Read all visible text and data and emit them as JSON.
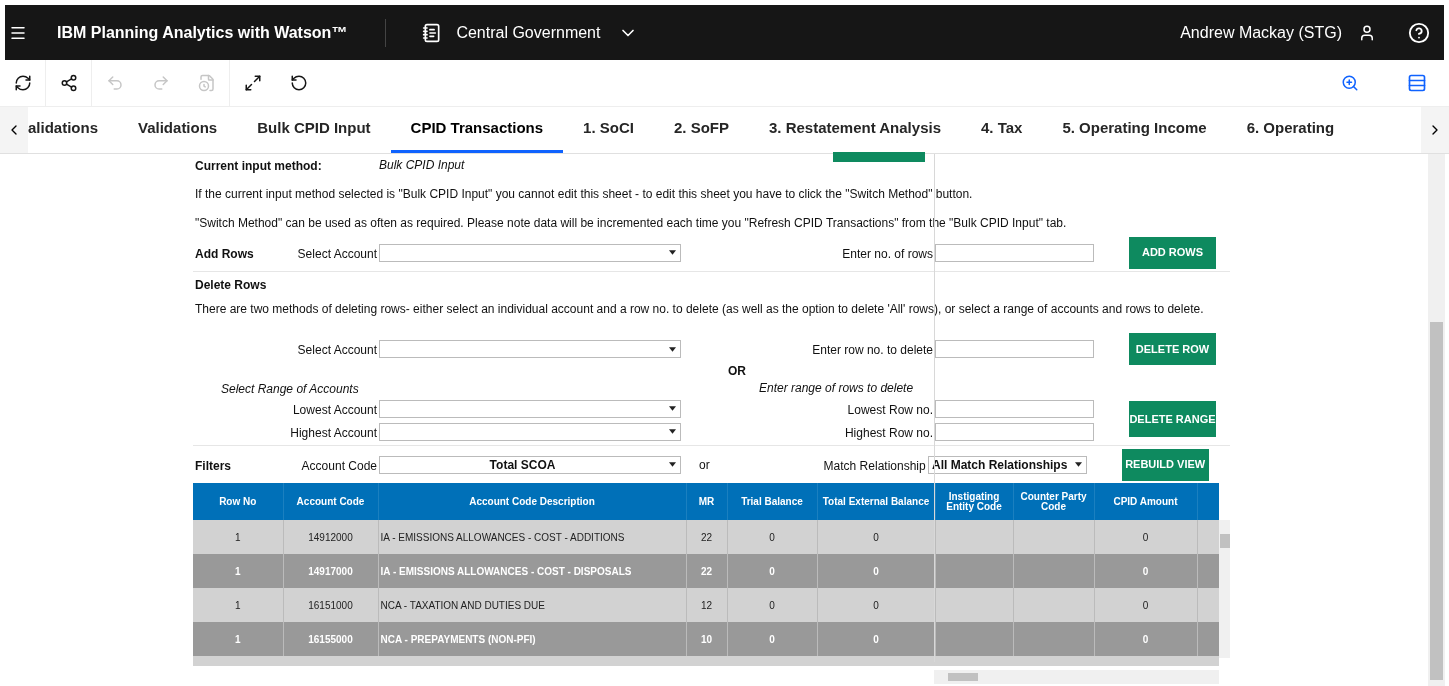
{
  "header": {
    "app_title": "IBM Planning Analytics with Watson™",
    "workbook": "Central Government",
    "user": "Andrew Mackay (STG)"
  },
  "toolbar": [
    {
      "kind": "refresh",
      "disabled": false
    },
    {
      "kind": "share",
      "disabled": false
    },
    {
      "kind": "undo",
      "disabled": true
    },
    {
      "kind": "redo",
      "disabled": true
    },
    {
      "kind": "revert",
      "disabled": true
    },
    {
      "kind": "expand",
      "disabled": false
    },
    {
      "kind": "reset",
      "disabled": false
    }
  ],
  "tabs": [
    {
      "label": "alidations",
      "selected": false
    },
    {
      "label": "Validations",
      "selected": false
    },
    {
      "label": "Bulk CPID Input",
      "selected": false
    },
    {
      "label": "CPID Transactions",
      "selected": true
    },
    {
      "label": "1. SoCI",
      "selected": false
    },
    {
      "label": "2. SoFP",
      "selected": false
    },
    {
      "label": "3. Restatement Analysis",
      "selected": false
    },
    {
      "label": "4. Tax",
      "selected": false
    },
    {
      "label": "5. Operating Income",
      "selected": false
    },
    {
      "label": "6. Operating",
      "selected": false
    }
  ],
  "sheet": {
    "current_method_label": "Current input method:",
    "current_method_value": "Bulk CPID Input",
    "notes": [
      "If the current input method selected is \"Bulk CPID Input\" you cannot edit this sheet - to edit this sheet you have to click the \"Switch Method\" button.",
      "\"Switch Method\" can be used as often as required. Please note data will be incremented each time you \"Refresh CPID Transactions\" from the \"Bulk CPID Input\" tab."
    ],
    "add_rows": {
      "title": "Add Rows",
      "account_label": "Select Account",
      "rows_label": "Enter no. of rows",
      "button": "ADD ROWS"
    },
    "delete_rows": {
      "title": "Delete Rows",
      "description": "There are two methods of deleting rows- either select an individual account and a row no. to delete (as well as the option to delete 'All' rows), or select a range of accounts and rows to delete.",
      "account_label": "Select Account",
      "row_label": "Enter row no. to delete",
      "delete_row_button": "DELETE ROW",
      "or": "OR",
      "range_accounts_label": "Select Range of Accounts",
      "range_rows_label": "Enter range of rows to delete",
      "lowest_account_label": "Lowest Account",
      "lowest_row_label": "Lowest Row no.",
      "highest_account_label": "Highest Account",
      "highest_row_label": "Highest Row no.",
      "delete_range_button": "DELETE RANGE"
    },
    "filters": {
      "title": "Filters",
      "account_label": "Account Code",
      "account_value": "Total SCOA",
      "or": "or",
      "match_label": "Match Relationship",
      "match_value": "All Match Relationships",
      "button": "REBUILD VIEW"
    }
  },
  "table": {
    "columns": [
      "Row No",
      "Account Code",
      "Account Code Description",
      "MR",
      "Trial Balance",
      "Total External Balance",
      "Instigating Entity Code",
      "Counter Party Code",
      "CPID Amount"
    ],
    "rows": [
      [
        "1",
        "14912000",
        "IA - EMISSIONS ALLOWANCES - COST - ADDITIONS",
        "22",
        "0",
        "0",
        "",
        "",
        "0"
      ],
      [
        "1",
        "14917000",
        "IA - EMISSIONS ALLOWANCES - COST - DISPOSALS",
        "22",
        "0",
        "0",
        "",
        "",
        "0"
      ],
      [
        "1",
        "16151000",
        "NCA - TAXATION AND DUTIES DUE",
        "12",
        "0",
        "0",
        "",
        "",
        "0"
      ],
      [
        "1",
        "16155000",
        "NCA - PREPAYMENTS (NON-PFI)",
        "10",
        "0",
        "0",
        "",
        "",
        "0"
      ]
    ]
  }
}
